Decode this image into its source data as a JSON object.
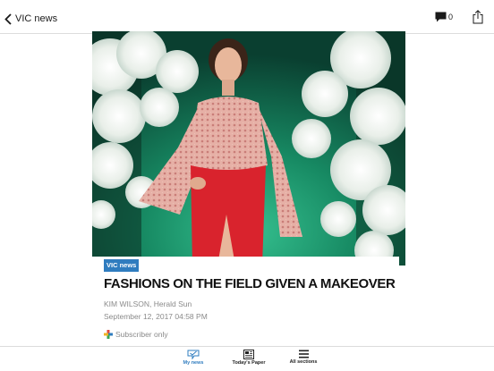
{
  "header": {
    "back_label": "VIC news",
    "comment_count": "0"
  },
  "article": {
    "section_tag": "VIC news",
    "headline": "FASHIONS ON THE FIELD GIVEN A MAKEOVER",
    "byline": "KIM WILSON, Herald Sun",
    "date": "September 12, 2017 04:58 PM",
    "access_label": "Subscriber only"
  },
  "tabs": [
    {
      "label": "My news",
      "icon": "my-news-icon",
      "active": true
    },
    {
      "label": "Today's Paper",
      "icon": "newspaper-icon",
      "active": false
    },
    {
      "label": "All sections",
      "icon": "menu-icon",
      "active": false
    }
  ],
  "colors": {
    "accent": "#2f7cbf",
    "hero_backdrop": "#0c5f48",
    "dress_top": "#e4a9a1",
    "skirt": "#d9232d"
  }
}
